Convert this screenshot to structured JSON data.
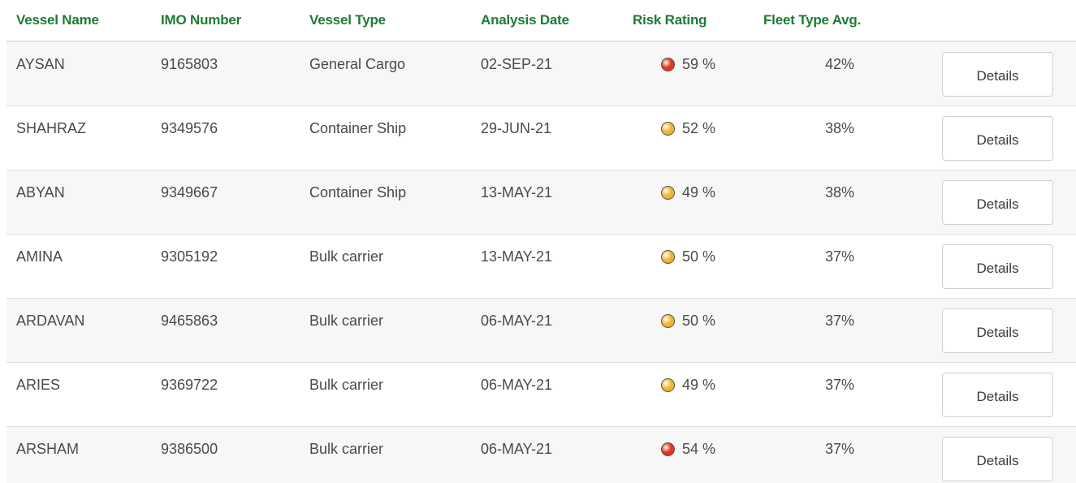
{
  "table": {
    "headers": {
      "vessel_name": "Vessel Name",
      "imo_number": "IMO Number",
      "vessel_type": "Vessel Type",
      "analysis_date": "Analysis Date",
      "risk_rating": "Risk Rating",
      "fleet_type_avg": "Fleet Type Avg."
    },
    "rows": [
      {
        "name": "AYSAN",
        "imo": "9165803",
        "type": "General Cargo",
        "date": "02-SEP-21",
        "risk": "59 %",
        "risk_level": "high",
        "risk_color": "#e8321c",
        "fleet_avg": "42%",
        "details": "Details"
      },
      {
        "name": "SHAHRAZ",
        "imo": "9349576",
        "type": "Container Ship",
        "date": "29-JUN-21",
        "risk": "52 %",
        "risk_level": "medium",
        "risk_color": "#f2b531",
        "fleet_avg": "38%",
        "details": "Details"
      },
      {
        "name": "ABYAN",
        "imo": "9349667",
        "type": "Container Ship",
        "date": "13-MAY-21",
        "risk": "49 %",
        "risk_level": "medium",
        "risk_color": "#f2b531",
        "fleet_avg": "38%",
        "details": "Details"
      },
      {
        "name": "AMINA",
        "imo": "9305192",
        "type": "Bulk carrier",
        "date": "13-MAY-21",
        "risk": "50 %",
        "risk_level": "medium",
        "risk_color": "#f2b531",
        "fleet_avg": "37%",
        "details": "Details"
      },
      {
        "name": "ARDAVAN",
        "imo": "9465863",
        "type": "Bulk carrier",
        "date": "06-MAY-21",
        "risk": "50 %",
        "risk_level": "medium",
        "risk_color": "#f2b531",
        "fleet_avg": "37%",
        "details": "Details"
      },
      {
        "name": "ARIES",
        "imo": "9369722",
        "type": "Bulk carrier",
        "date": "06-MAY-21",
        "risk": "49 %",
        "risk_level": "medium",
        "risk_color": "#f2b531",
        "fleet_avg": "37%",
        "details": "Details"
      },
      {
        "name": "ARSHAM",
        "imo": "9386500",
        "type": "Bulk carrier",
        "date": "06-MAY-21",
        "risk": "54 %",
        "risk_level": "high",
        "risk_color": "#e8321c",
        "fleet_avg": "37%",
        "details": "Details"
      }
    ]
  },
  "colors": {
    "header_text": "#1e7b34",
    "risk_high": "#e8321c",
    "risk_medium": "#f2b531"
  }
}
